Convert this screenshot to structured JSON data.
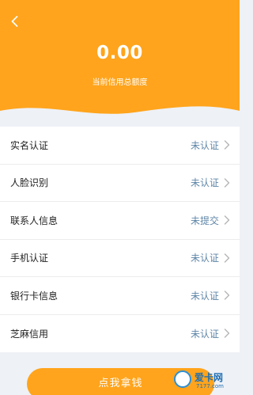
{
  "header": {
    "amount": "0.00",
    "amount_label": "当前信用总额度",
    "brand_color": "#ffa41c"
  },
  "verify_items": [
    {
      "label": "实名认证",
      "status": "未认证"
    },
    {
      "label": "人脸识别",
      "status": "未认证"
    },
    {
      "label": "联系人信息",
      "status": "未提交"
    },
    {
      "label": "手机认证",
      "status": "未认证"
    },
    {
      "label": "银行卡信息",
      "status": "未认证"
    },
    {
      "label": "芝麻信用",
      "status": "未认证"
    }
  ],
  "cta": {
    "label": "点我拿钱"
  },
  "watermark": {
    "title": "爱卡网",
    "subtitle": "7177.com"
  },
  "icons": [
    "back-icon",
    "chevron-right-icon"
  ],
  "colors": {
    "status_text": "#5f86a8",
    "background": "#eef1f6"
  }
}
